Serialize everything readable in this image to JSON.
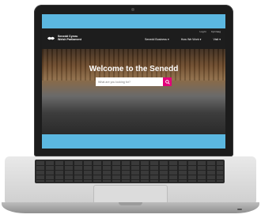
{
  "site": {
    "logo": {
      "line1": "Senedd Cymru",
      "line2": "Welsh Parliament",
      "icon": "senedd-logo-icon"
    },
    "utility": [
      "Log In",
      "Cymraeg"
    ],
    "nav": [
      "Senedd Business",
      "How We Work",
      "Visit"
    ],
    "hero_title": "Welcome to the Senedd",
    "search": {
      "placeholder": "What are you looking for?",
      "button_icon": "search-icon",
      "button_color": "#e2007a"
    },
    "screen_bg": "#5bb7e0"
  }
}
